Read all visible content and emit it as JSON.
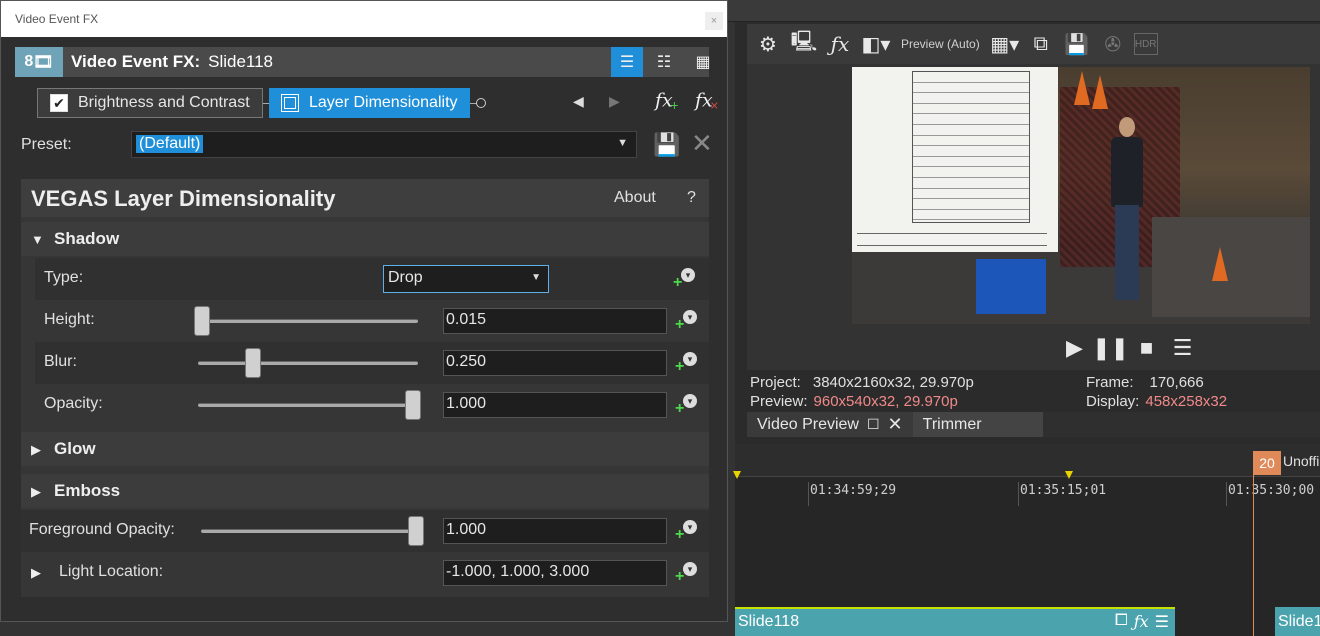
{
  "fx_window": {
    "title": "Video Event FX",
    "close_glyph": "×",
    "header_label": "Video Event FX:",
    "event_name": "Slide118",
    "logo_glyph": "8",
    "view_buttons": [
      "list",
      "grid-medium",
      "grid-large"
    ],
    "chain": [
      {
        "label": "Brightness and Contrast",
        "checked": true,
        "active": false
      },
      {
        "label": "Layer Dimensionality",
        "checked": true,
        "active": true
      }
    ],
    "nav_prev": "◀",
    "nav_next": "▶",
    "fx_glyph": "fx",
    "fx_add_mark": "+",
    "fx_remove_mark": "×"
  },
  "preset": {
    "label": "Preset:",
    "value": "(Default)"
  },
  "plugin": {
    "title": "VEGAS Layer Dimensionality",
    "about": "About",
    "help": "?",
    "sections": {
      "shadow": "Shadow",
      "glow": "Glow",
      "emboss": "Emboss"
    },
    "props": {
      "type_label": "Type:",
      "type_value": "Drop",
      "height_label": "Height:",
      "height_value": "0.015",
      "height_level": 0.015,
      "blur_label": "Blur:",
      "blur_value": "0.250",
      "blur_level": 0.25,
      "opacity_label": "Opacity:",
      "opacity_value": "1.000",
      "opacity_level": 1.0,
      "fg_opacity_label": "Foreground Opacity:",
      "fg_opacity_value": "1.000",
      "fg_opacity_level": 1.0,
      "light_location_label": "Light Location:",
      "light_location_value": "-1.000, 1.000, 3.000"
    }
  },
  "preview": {
    "quality": "Preview (Auto)",
    "stats": {
      "project_label": "Project:",
      "project_value": "3840x2160x32, 29.970p",
      "preview_label": "Preview:",
      "preview_value": "960x540x32, 29.970p",
      "frame_label": "Frame:",
      "frame_value": "170,666",
      "display_label": "Display:",
      "display_value": "458x258x32"
    },
    "tabs": {
      "video_preview": "Video Preview",
      "trimmer": "Trimmer"
    }
  },
  "timeline": {
    "ruler": [
      "01:34:59;29",
      "01:35:15;01",
      "01:35:30;00"
    ],
    "marker_number": "20",
    "marker_label": "Unoffic",
    "clips": [
      "Slide118",
      "Slide1"
    ]
  },
  "colors": {
    "accent": "#1f8fd9",
    "clip": "#4aa3ad",
    "playhead": "#e08a5a",
    "stat_highlight": "#f08a8a"
  }
}
